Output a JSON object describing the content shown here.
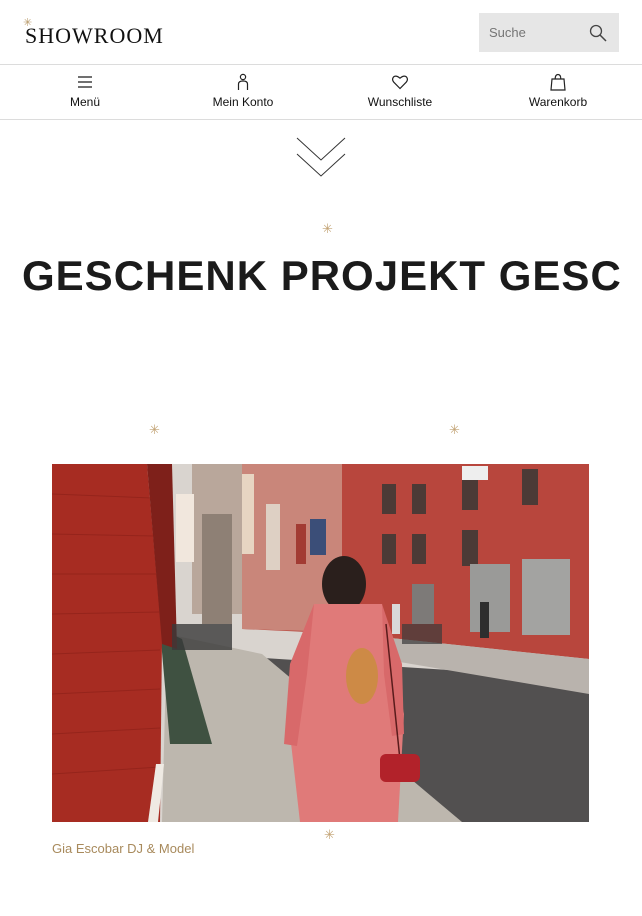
{
  "header": {
    "logo": "SHOWROOM",
    "search_placeholder": "Suche"
  },
  "nav": {
    "items": [
      {
        "label": "Menü",
        "icon": "hamburger-icon"
      },
      {
        "label": "Mein Konto",
        "icon": "user-icon"
      },
      {
        "label": "Wunschliste",
        "icon": "heart-icon"
      },
      {
        "label": "Warenkorb",
        "icon": "shopping-bag-icon"
      }
    ]
  },
  "hero": {
    "headline": "GESCHENK PROJEKT GESCHENK PROJEKT"
  },
  "feature": {
    "caption": "Gia Escobar DJ & Model"
  },
  "colors": {
    "accent": "#c2a273",
    "caption": "#a88a5c",
    "search_bg": "#e6e6e6",
    "divider": "#dcdcdc"
  }
}
